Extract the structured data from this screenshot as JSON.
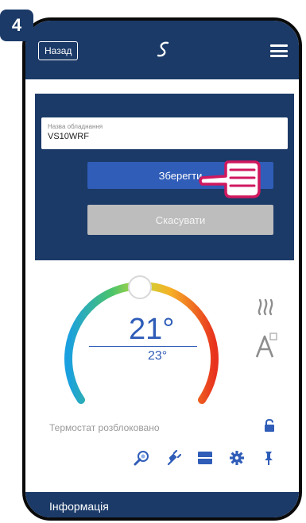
{
  "step_number": "4",
  "topbar": {
    "back_label": "Назад",
    "logo_icon": "salus-logo-icon",
    "menu_icon": "hamburger-menu-icon"
  },
  "device_name": {
    "label": "Назва обладнання",
    "value": "VS10WRF"
  },
  "actions": {
    "save_label": "Зберегти",
    "cancel_label": "Скасувати"
  },
  "thermostat": {
    "current_temp": "21°",
    "set_temp": "23°",
    "heating_icon": "heating-waves-icon",
    "auto_icon": "auto-mode-icon"
  },
  "lock_status": "Термостат розблоковано",
  "tools": [
    "search-icon",
    "plug-icon",
    "schedule-icon",
    "settings-gear-icon",
    "pin-icon"
  ],
  "footer": {
    "info_label": "Інформація"
  },
  "colors": {
    "navy": "#1b3a68",
    "blue": "#2f5db8",
    "grey_button": "#bdbdbd",
    "hand_outline": "#d0185f"
  }
}
